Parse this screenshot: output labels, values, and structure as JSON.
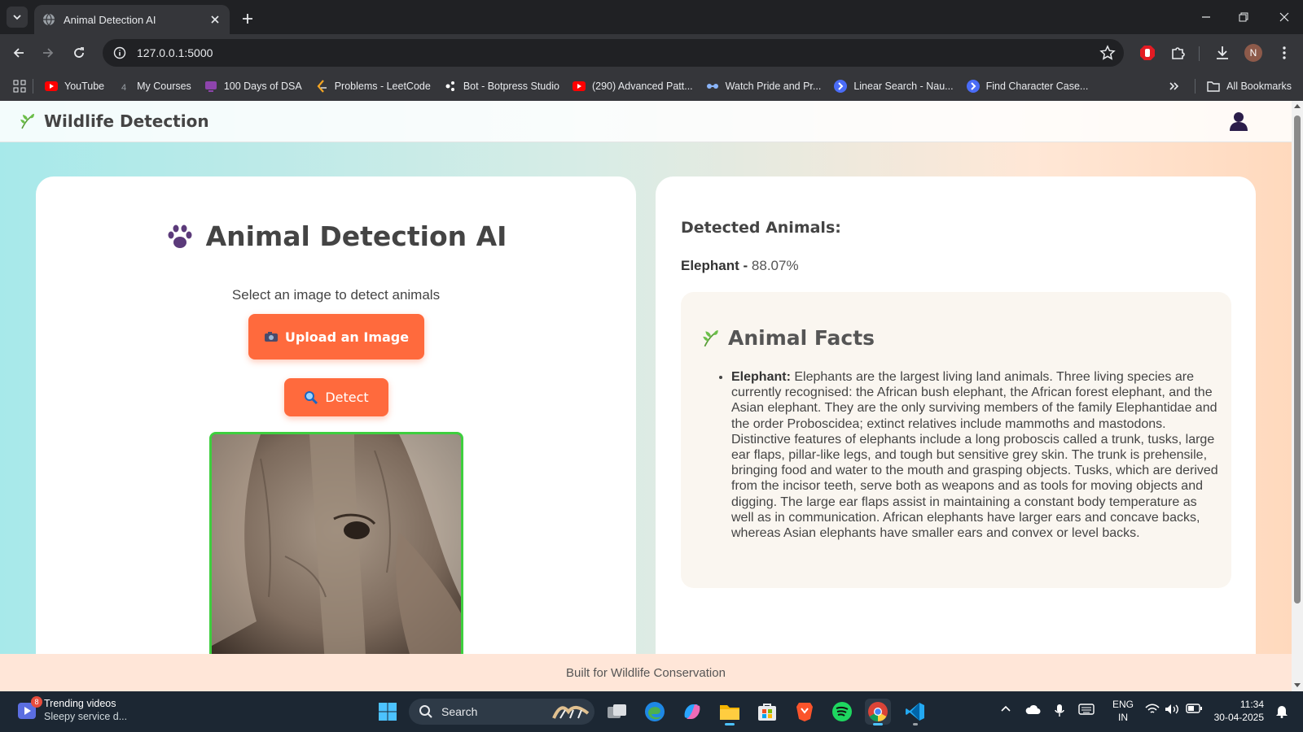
{
  "browser": {
    "tab_title": "Animal Detection AI",
    "url": "127.0.0.1:5000",
    "profile_initial": "N"
  },
  "bookmarks": {
    "items": [
      {
        "label": "YouTube",
        "icon": "youtube-icon",
        "color": "#ff0000"
      },
      {
        "label": "My Courses",
        "icon": "courses-icon",
        "color": "#9aa0a6"
      },
      {
        "label": "100 Days of DSA",
        "icon": "tv-icon",
        "color": "#8e44ad"
      },
      {
        "label": "Problems - LeetCode",
        "icon": "leetcode-icon",
        "color": "#f5a623"
      },
      {
        "label": "Bot - Botpress Studio",
        "icon": "botpress-icon",
        "color": "#ffffff"
      },
      {
        "label": "(290) Advanced Patt...",
        "icon": "youtube-icon",
        "color": "#ff0000"
      },
      {
        "label": "Watch Pride and Pr...",
        "icon": "watch-icon",
        "color": "#8ab4f8"
      },
      {
        "label": "Linear Search - Nau...",
        "icon": "naukri-icon",
        "color": "#4a6cf7"
      },
      {
        "label": "Find Character Case...",
        "icon": "naukri-icon",
        "color": "#4a6cf7"
      }
    ],
    "all_bookmarks": "All Bookmarks"
  },
  "app": {
    "brand": "Wildlife Detection",
    "title": "Animal Detection AI",
    "subtitle": "Select an image to detect animals",
    "upload_label": "Upload an Image",
    "detect_label": "Detect",
    "accent": "#ff6a3d",
    "preview_border": "#3ecf3e"
  },
  "results": {
    "heading": "Detected Animals:",
    "animal": "Elephant",
    "confidence_text": "88.07%",
    "confidence": 88.07
  },
  "facts": {
    "heading": "Animal Facts",
    "items": [
      {
        "name": "Elephant:",
        "text": "Elephants are the largest living land animals. Three living species are currently recognised: the African bush elephant, the African forest elephant, and the Asian elephant. They are the only surviving members of the family Elephantidae and the order Proboscidea; extinct relatives include mammoths and mastodons. Distinctive features of elephants include a long proboscis called a trunk, tusks, large ear flaps, pillar-like legs, and tough but sensitive grey skin. The trunk is prehensile, bringing food and water to the mouth and grasping objects. Tusks, which are derived from the incisor teeth, serve both as weapons and as tools for moving objects and digging. The large ear flaps assist in maintaining a constant body temperature as well as in communication. African elephants have larger ears and concave backs, whereas Asian elephants have smaller ears and convex or level backs."
      }
    ]
  },
  "footer": {
    "text": "Built for Wildlife Conservation"
  },
  "taskbar": {
    "widget_badge": "8",
    "widget_title": "Trending videos",
    "widget_sub": "Sleepy service d...",
    "search_label": "Search",
    "lang_top": "ENG",
    "lang_bottom": "IN",
    "time": "11:34",
    "date": "30-04-2025"
  }
}
